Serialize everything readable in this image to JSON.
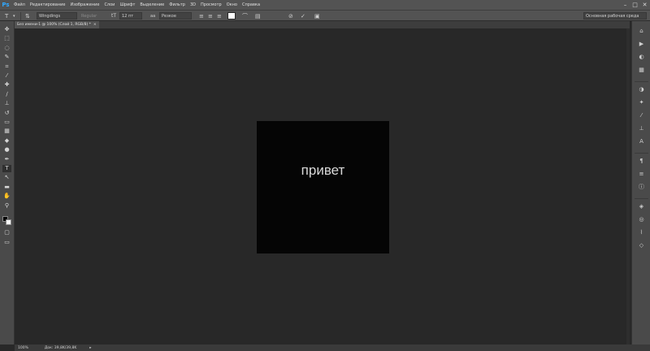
{
  "app": {
    "logo": "Ps"
  },
  "menu": [
    "Файл",
    "Редактирование",
    "Изображение",
    "Слои",
    "Шрифт",
    "Выделение",
    "Фильтр",
    "3D",
    "Просмотр",
    "Окно",
    "Справка"
  ],
  "window_controls": {
    "minimize": "–",
    "maximize": "□",
    "close": "✕"
  },
  "options": {
    "font_family": "Wingdings",
    "font_style": "Regular",
    "font_size": "12 пт",
    "aa_prefix": "aa",
    "antialias": "Резкое",
    "workspace": "Основная рабочая среда"
  },
  "document": {
    "tab_label": "Без имени-1 @ 100% (Слой 1, RGB/8) *",
    "close": "×",
    "canvas_text": "привет"
  },
  "status": {
    "zoom": "100%",
    "doc_info": "Док: 39,8K/39,8K",
    "arrow": "▸"
  },
  "tools": [
    {
      "name": "move-tool",
      "glyph": "✥"
    },
    {
      "name": "marquee-tool",
      "glyph": "⬚"
    },
    {
      "name": "lasso-tool",
      "glyph": "◌"
    },
    {
      "name": "quick-select-tool",
      "glyph": "✎"
    },
    {
      "name": "crop-tool",
      "glyph": "⌗"
    },
    {
      "name": "eyedropper-tool",
      "glyph": "⁄"
    },
    {
      "name": "healing-tool",
      "glyph": "✚"
    },
    {
      "name": "brush-tool",
      "glyph": "∕"
    },
    {
      "name": "stamp-tool",
      "glyph": "⊥"
    },
    {
      "name": "history-brush-tool",
      "glyph": "↺"
    },
    {
      "name": "eraser-tool",
      "glyph": "▭"
    },
    {
      "name": "gradient-tool",
      "glyph": "▦"
    },
    {
      "name": "blur-tool",
      "glyph": "◆"
    },
    {
      "name": "dodge-tool",
      "glyph": "●"
    },
    {
      "name": "pen-tool",
      "glyph": "✒"
    },
    {
      "name": "type-tool",
      "glyph": "T"
    },
    {
      "name": "path-select-tool",
      "glyph": "↖"
    },
    {
      "name": "shape-tool",
      "glyph": "▬"
    },
    {
      "name": "hand-tool",
      "glyph": "✋"
    },
    {
      "name": "zoom-tool",
      "glyph": "⚲"
    }
  ],
  "panel_icons": [
    {
      "name": "history-panel-icon",
      "glyph": "⌂"
    },
    {
      "name": "actions-panel-icon",
      "glyph": "▶"
    },
    {
      "name": "color-panel-icon",
      "glyph": "◐"
    },
    {
      "name": "swatches-panel-icon",
      "glyph": "▦"
    },
    {
      "name": "adjustments-panel-icon",
      "glyph": "◑"
    },
    {
      "name": "styles-panel-icon",
      "glyph": "✦"
    },
    {
      "name": "brush-panel-icon",
      "glyph": "⁄"
    },
    {
      "name": "clone-source-panel-icon",
      "glyph": "⊥"
    },
    {
      "name": "character-panel-icon",
      "glyph": "A"
    },
    {
      "name": "paragraph-panel-icon",
      "glyph": "¶"
    },
    {
      "name": "properties-panel-icon",
      "glyph": "≡"
    },
    {
      "name": "info-panel-icon",
      "glyph": "ⓘ"
    },
    {
      "name": "layers-panel-icon",
      "glyph": "◈"
    },
    {
      "name": "channels-panel-icon",
      "glyph": "◎"
    },
    {
      "name": "paths-panel-icon",
      "glyph": "⌇"
    },
    {
      "name": "3d-panel-icon",
      "glyph": "◇"
    }
  ]
}
